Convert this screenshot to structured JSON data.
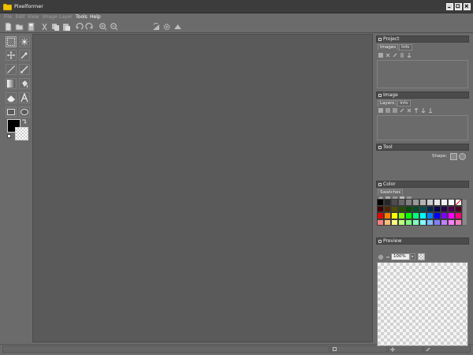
{
  "window": {
    "title": "Pixelformer",
    "icon": "folder-icon",
    "controls": [
      "minimize-icon",
      "maximize-icon",
      "close-icon"
    ]
  },
  "menu": {
    "file": "File",
    "edit": "Edit",
    "view": "View",
    "image": "Image",
    "layer": "Layer",
    "tools": "Tools",
    "help": "Help"
  },
  "toolbar": {
    "zoom_value": "",
    "icons": [
      "new-icon",
      "open-icon",
      "save-icon",
      "cut-icon",
      "copy-icon",
      "paste-icon",
      "undo-icon",
      "redo-icon",
      "zoom-in-icon",
      "zoom-out-icon",
      "zoom-dropdown",
      "rotate-icon",
      "gear-icon",
      "triangle-icon"
    ]
  },
  "tools": [
    "rect-select-icon",
    "magic-wand-icon",
    "move-icon",
    "eyedropper-icon",
    "line-icon",
    "brush-icon",
    "gradient-icon",
    "fill-icon",
    "eraser-icon",
    "text-icon",
    "rectangle-icon",
    "ellipse-icon"
  ],
  "colors": {
    "foreground": "#000000",
    "background": "transparent",
    "canvas": "#5a5a5a",
    "window_bg": "#6b6b6b"
  },
  "project": {
    "title": "Project",
    "tabs": [
      "Images",
      "Info"
    ]
  },
  "image_panel": {
    "title": "Image",
    "tabs": [
      "Layers",
      "Info"
    ]
  },
  "tool_panel": {
    "title": "Tool",
    "shape_label": "Shape:"
  },
  "color_panel": {
    "title": "Color",
    "tabs": [
      "Swatches"
    ],
    "swatches": [
      "#000000",
      "#262626",
      "#4d4d4d",
      "#666666",
      "#808080",
      "#999999",
      "#b3b3b3",
      "#cccccc",
      "#e6e6e6",
      "#f2f2f2",
      "#ffffff",
      "#ffffff",
      "#3d0000",
      "#4d2600",
      "#4d4d00",
      "#264d00",
      "#004d00",
      "#004d26",
      "#004d4d",
      "#00264d",
      "#00004d",
      "#26004d",
      "#4d004d",
      "#4d0026",
      "#e60000",
      "#ff7f00",
      "#ffff00",
      "#7fff00",
      "#00ff00",
      "#00ff7f",
      "#00ffff",
      "#007fff",
      "#0000ff",
      "#7f00ff",
      "#ff00ff",
      "#ff007f",
      "#ff8080",
      "#ffbf80",
      "#ffff80",
      "#bfff80",
      "#80ff80",
      "#80ffbf",
      "#80ffff",
      "#80bfff",
      "#8080ff",
      "#bf80ff",
      "#ff80ff",
      "#ff80bf"
    ]
  },
  "preview_panel": {
    "title": "Preview",
    "zoom": "100%"
  }
}
